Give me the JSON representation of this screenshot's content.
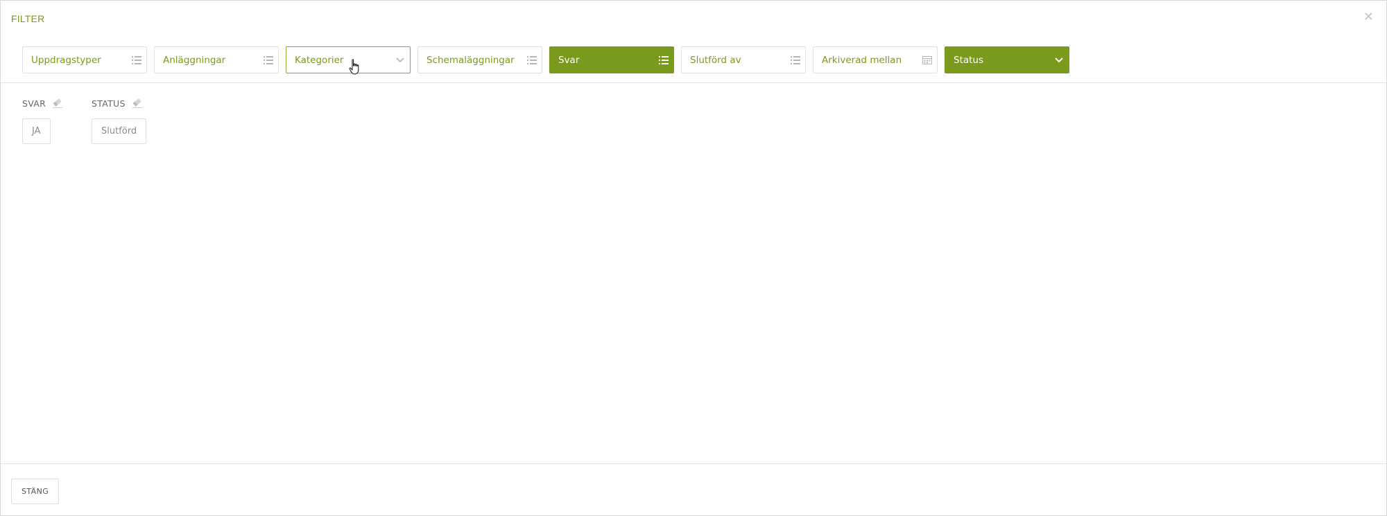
{
  "header": {
    "title": "FILTER",
    "close_icon": "close-icon"
  },
  "toolbar": {
    "filters": [
      {
        "label": "Uppdragstyper",
        "icon": "list-icon",
        "state": "default"
      },
      {
        "label": "Anläggningar",
        "icon": "list-icon",
        "state": "default"
      },
      {
        "label": "Kategorier",
        "icon": "chevron-down-icon",
        "state": "hover"
      },
      {
        "label": "Schemaläggningar",
        "icon": "list-icon",
        "state": "default"
      },
      {
        "label": "Svar",
        "icon": "list-icon",
        "state": "active"
      },
      {
        "label": "Slutförd av",
        "icon": "list-icon",
        "state": "default"
      },
      {
        "label": "Arkiverad mellan",
        "icon": "calendar-icon",
        "state": "default"
      },
      {
        "label": "Status",
        "icon": "chevron-down-icon",
        "state": "active"
      }
    ]
  },
  "active_filters": [
    {
      "label": "SVAR",
      "value": "JA",
      "icon": "eraser-icon"
    },
    {
      "label": "STATUS",
      "value": "Slutförd",
      "icon": "eraser-icon"
    }
  ],
  "footer": {
    "close_label": "STÄNG"
  },
  "colors": {
    "accent": "#7a9a1e",
    "border": "#e0e0e0",
    "muted_icon": "#b5b5b5"
  }
}
